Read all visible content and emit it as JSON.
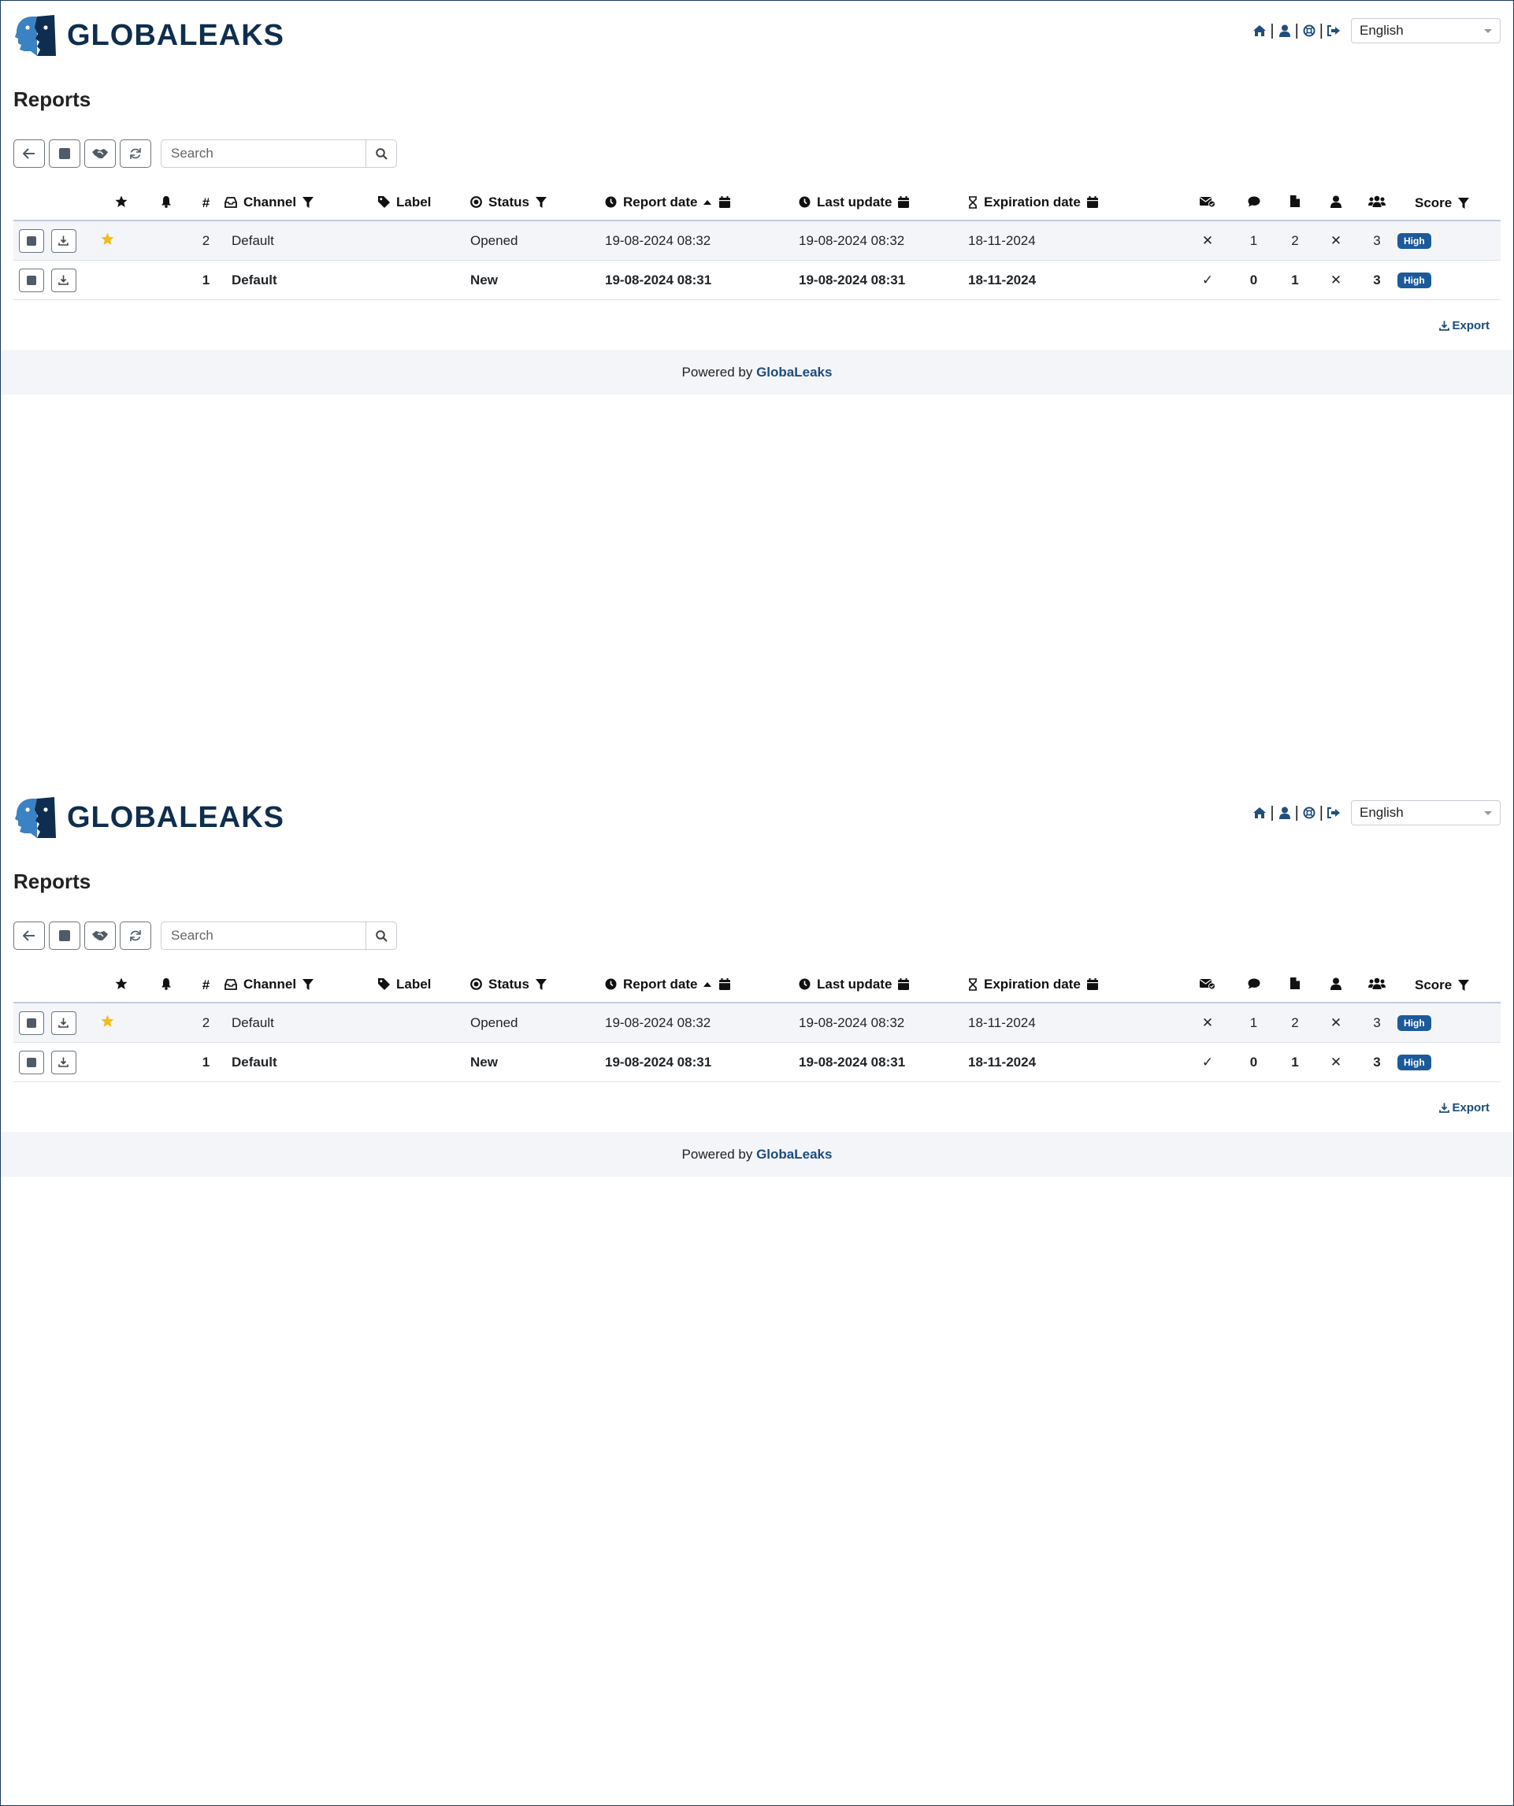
{
  "app": {
    "brand": "GLOBALEAKS",
    "language": "English",
    "page_title": "Reports",
    "search_placeholder": "Search",
    "export_label": "Export",
    "footer_prefix": "Powered by",
    "footer_brand": "GlobaLeaks"
  },
  "table": {
    "headers": {
      "number": "#",
      "channel": "Channel",
      "label": "Label",
      "status": "Status",
      "report_date": "Report date",
      "last_update": "Last update",
      "expiration_date": "Expiration date",
      "score": "Score"
    },
    "rows": [
      {
        "important": true,
        "id": "2",
        "channel": "Default",
        "label": "",
        "status": "Opened",
        "report_date": "19-08-2024 08:32",
        "last_update": "19-08-2024 08:32",
        "expiration_date": "18-11-2024",
        "read": "✕",
        "comments": "1",
        "files": "2",
        "identity": "✕",
        "recipients": "3",
        "score": "High"
      },
      {
        "important": false,
        "id": "1",
        "channel": "Default",
        "label": "",
        "status": "New",
        "report_date": "19-08-2024 08:31",
        "last_update": "19-08-2024 08:31",
        "expiration_date": "18-11-2024",
        "read": "✓",
        "comments": "0",
        "files": "1",
        "identity": "✕",
        "recipients": "3",
        "score": "High"
      }
    ]
  },
  "colors": {
    "brand_dark": "#0f2e4f",
    "brand_blue": "#1b4d7d",
    "badge_blue": "#1c5a9a",
    "star_yellow": "#f5bb16"
  }
}
